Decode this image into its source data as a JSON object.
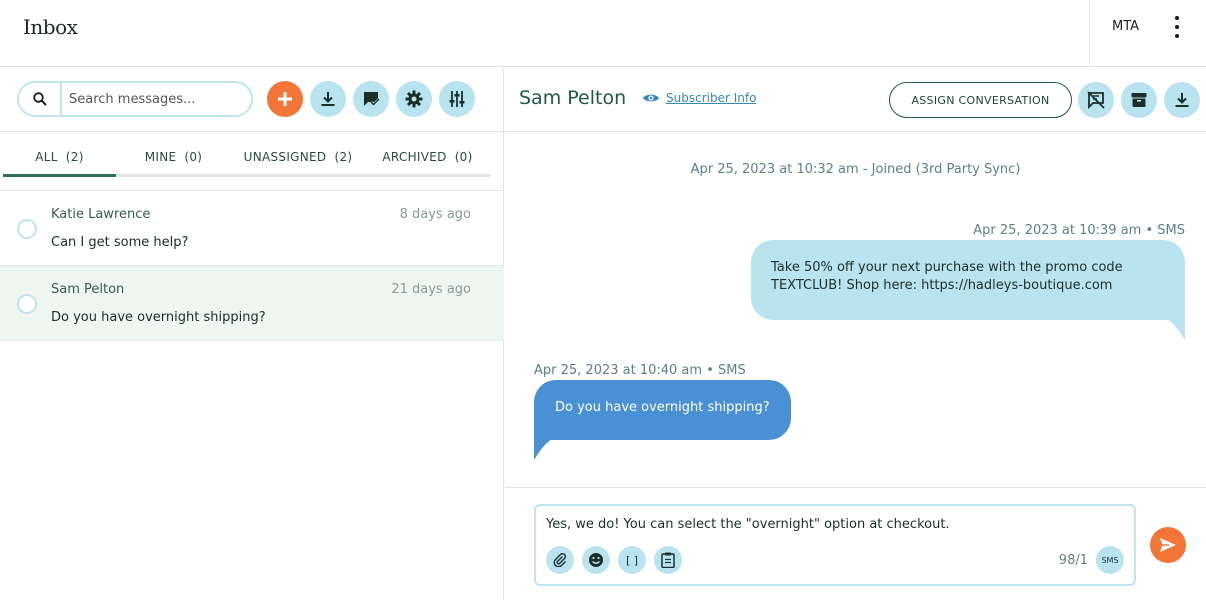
{
  "app": {
    "title": "Inbox",
    "org_label": "MTA"
  },
  "sidebar": {
    "search": {
      "placeholder": "Search messages...",
      "value": ""
    },
    "toolbar": [
      {
        "name": "new-message-button",
        "icon": "plus-icon"
      },
      {
        "name": "download-button",
        "icon": "download-icon"
      },
      {
        "name": "mark-read-button",
        "icon": "chat-check-icon"
      },
      {
        "name": "settings-button",
        "icon": "gear-icon"
      },
      {
        "name": "filter-button",
        "icon": "sliders-icon"
      }
    ],
    "tabs": [
      {
        "label": "ALL",
        "count": "(2)",
        "active": true
      },
      {
        "label": "MINE",
        "count": "(0)",
        "active": false
      },
      {
        "label": "UNASSIGNED",
        "count": "(2)",
        "active": false
      },
      {
        "label": "ARCHIVED",
        "count": "(0)",
        "active": false
      }
    ],
    "conversations": [
      {
        "name": "Katie Lawrence",
        "time": "8 days ago",
        "message": "Can I get some help?",
        "selected": false
      },
      {
        "name": "Sam Pelton",
        "time": "21 days ago",
        "message": "Do you have overnight shipping?",
        "selected": true
      }
    ]
  },
  "chat": {
    "contact_name": "Sam Pelton",
    "subscriber_link": "Subscriber Info",
    "assign_label": "ASSIGN CONVERSATION",
    "system_event": "Apr 25, 2023 at 10:32 am - Joined (3rd Party Sync)",
    "outgoing": {
      "meta": "Apr 25, 2023 at 10:39 am  •  SMS",
      "text": "Take 50% off your next purchase with the promo code TEXTCLUB! Shop here: https://hadleys-boutique.com"
    },
    "incoming": {
      "meta": "Apr 25, 2023 at 10:40 am  •  SMS",
      "text": "Do you have overnight shipping?"
    },
    "composer": {
      "value": "Yes, we do! You can select the \"overnight\" option at checkout.",
      "char_count": "98/1",
      "channel": "SMS",
      "merge_label": "[ ]"
    }
  },
  "colors": {
    "accent_light": "#b9e4ef",
    "accent_orange": "#f47538",
    "brand_green": "#1e5a46",
    "incoming_bubble": "#4a90d4"
  }
}
